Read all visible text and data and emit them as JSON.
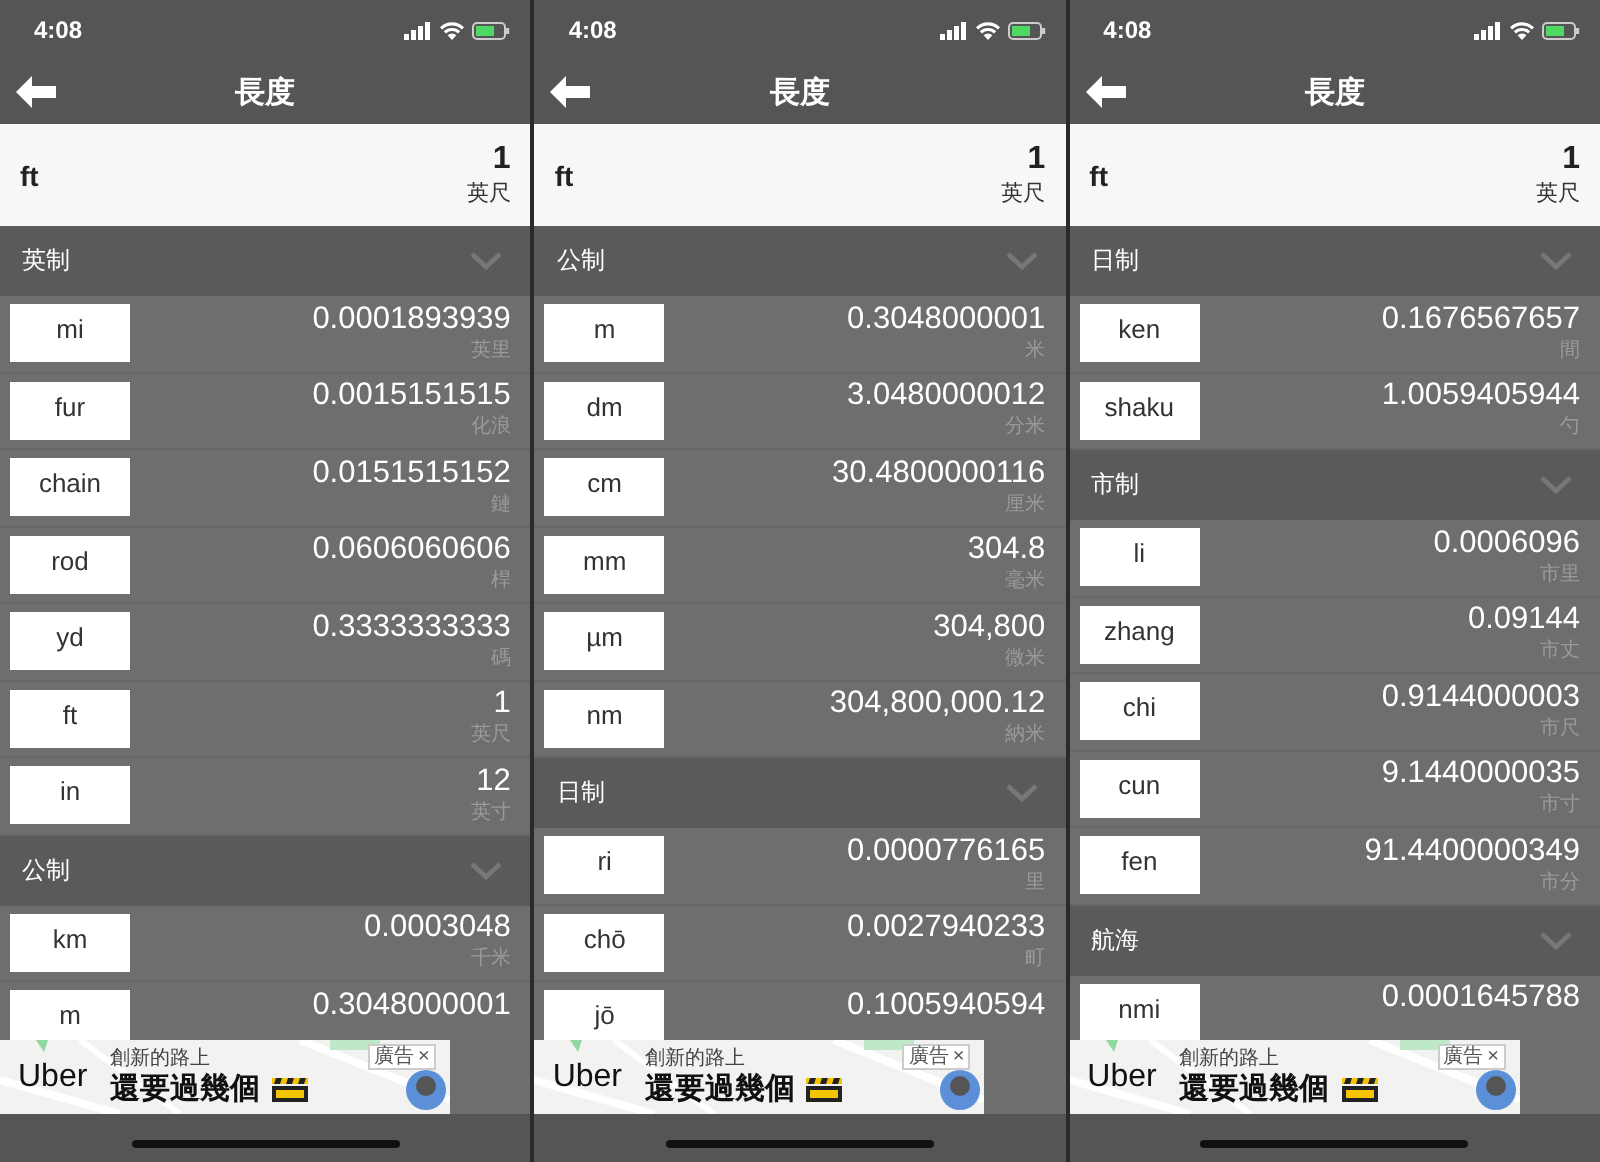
{
  "screens": [
    {
      "status_bar": {
        "time": "4:08"
      },
      "title": "長度",
      "header": {
        "unit": "ft",
        "value": "1",
        "name": "英尺"
      },
      "sections": [
        {
          "title": "英制",
          "rows": [
            {
              "unit": "mi",
              "value": "0.0001893939",
              "name": "英里"
            },
            {
              "unit": "fur",
              "value": "0.0015151515",
              "name": "化浪"
            },
            {
              "unit": "chain",
              "value": "0.0151515152",
              "name": "鏈"
            },
            {
              "unit": "rod",
              "value": "0.0606060606",
              "name": "桿"
            },
            {
              "unit": "yd",
              "value": "0.3333333333",
              "name": "碼"
            },
            {
              "unit": "ft",
              "value": "1",
              "name": "英尺"
            },
            {
              "unit": "in",
              "value": "12",
              "name": "英寸"
            }
          ]
        },
        {
          "title": "公制",
          "rows": [
            {
              "unit": "km",
              "value": "0.0003048",
              "name": "千米"
            },
            {
              "unit": "m",
              "value": "0.3048000001"
            }
          ]
        }
      ],
      "ad": {
        "brand": "Uber",
        "tagline": "創新的路上",
        "headline": "還要過幾個",
        "badge": "廣告",
        "close": "×"
      }
    },
    {
      "status_bar": {
        "time": "4:08"
      },
      "title": "長度",
      "header": {
        "unit": "ft",
        "value": "1",
        "name": "英尺"
      },
      "sections": [
        {
          "title": "公制",
          "rows": [
            {
              "unit": "m",
              "value": "0.3048000001",
              "name": "米"
            },
            {
              "unit": "dm",
              "value": "3.0480000012",
              "name": "分米"
            },
            {
              "unit": "cm",
              "value": "30.4800000116",
              "name": "厘米"
            },
            {
              "unit": "mm",
              "value": "304.8",
              "name": "毫米"
            },
            {
              "unit": "µm",
              "value": "304,800",
              "name": "微米"
            },
            {
              "unit": "nm",
              "value": "304,800,000.12",
              "name": "納米"
            }
          ]
        },
        {
          "title": "日制",
          "rows": [
            {
              "unit": "ri",
              "value": "0.0000776165",
              "name": "里"
            },
            {
              "unit": "chō",
              "value": "0.0027940233",
              "name": "町"
            },
            {
              "unit": "jō",
              "value": "0.1005940594"
            }
          ]
        }
      ],
      "ad": {
        "brand": "Uber",
        "tagline": "創新的路上",
        "headline": "還要過幾個",
        "badge": "廣告",
        "close": "×"
      }
    },
    {
      "status_bar": {
        "time": "4:08"
      },
      "title": "長度",
      "header": {
        "unit": "ft",
        "value": "1",
        "name": "英尺"
      },
      "sections": [
        {
          "title": "日制",
          "rows": [
            {
              "unit": "ken",
              "value": "0.1676567657",
              "name": "間"
            },
            {
              "unit": "shaku",
              "value": "1.0059405944",
              "name": "勺"
            }
          ]
        },
        {
          "title": "市制",
          "rows": [
            {
              "unit": "li",
              "value": "0.0006096",
              "name": "市里"
            },
            {
              "unit": "zhang",
              "value": "0.09144",
              "name": "市丈"
            },
            {
              "unit": "chi",
              "value": "0.9144000003",
              "name": "市尺"
            },
            {
              "unit": "cun",
              "value": "9.1440000035",
              "name": "市寸"
            },
            {
              "unit": "fen",
              "value": "91.4400000349",
              "name": "市分"
            }
          ]
        },
        {
          "title": "航海",
          "rows": [
            {
              "unit": "nmi",
              "value": "0.0001645788"
            }
          ]
        }
      ],
      "ad": {
        "brand": "Uber",
        "tagline": "創新的路上",
        "headline": "還要過幾個",
        "badge": "廣告",
        "close": "×"
      }
    }
  ]
}
